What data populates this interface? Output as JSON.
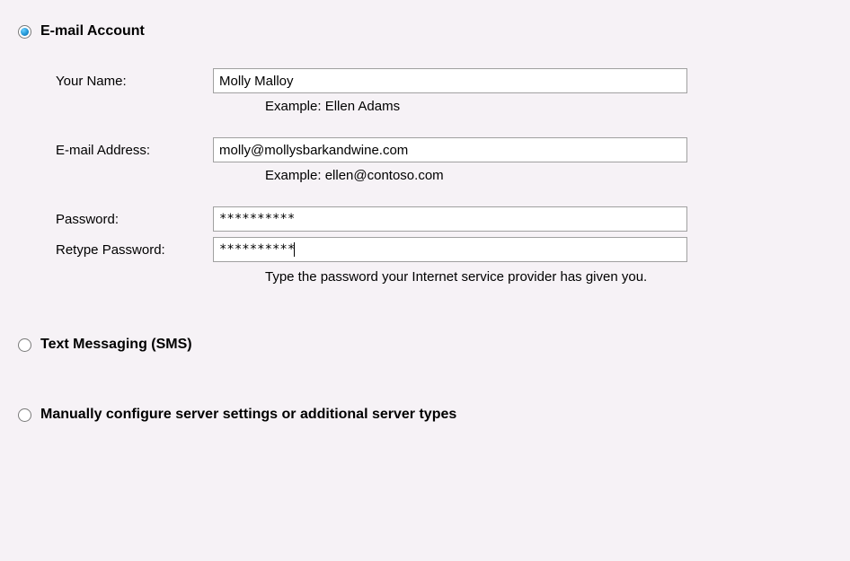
{
  "options": {
    "email_account": {
      "label": "E-mail Account",
      "selected": true
    },
    "text_messaging": {
      "label": "Text Messaging (SMS)",
      "selected": false
    },
    "manual_config": {
      "label": "Manually configure server settings or additional server types",
      "selected": false
    }
  },
  "form": {
    "your_name": {
      "label": "Your Name:",
      "value": "Molly Malloy",
      "hint": "Example: Ellen Adams"
    },
    "email_address": {
      "label": "E-mail Address:",
      "value": "molly@mollysbarkandwine.com",
      "hint": "Example: ellen@contoso.com"
    },
    "password": {
      "label": "Password:",
      "value": "**********"
    },
    "retype_password": {
      "label": "Retype Password:",
      "value": "**********",
      "hint": "Type the password your Internet service provider has given you."
    }
  }
}
